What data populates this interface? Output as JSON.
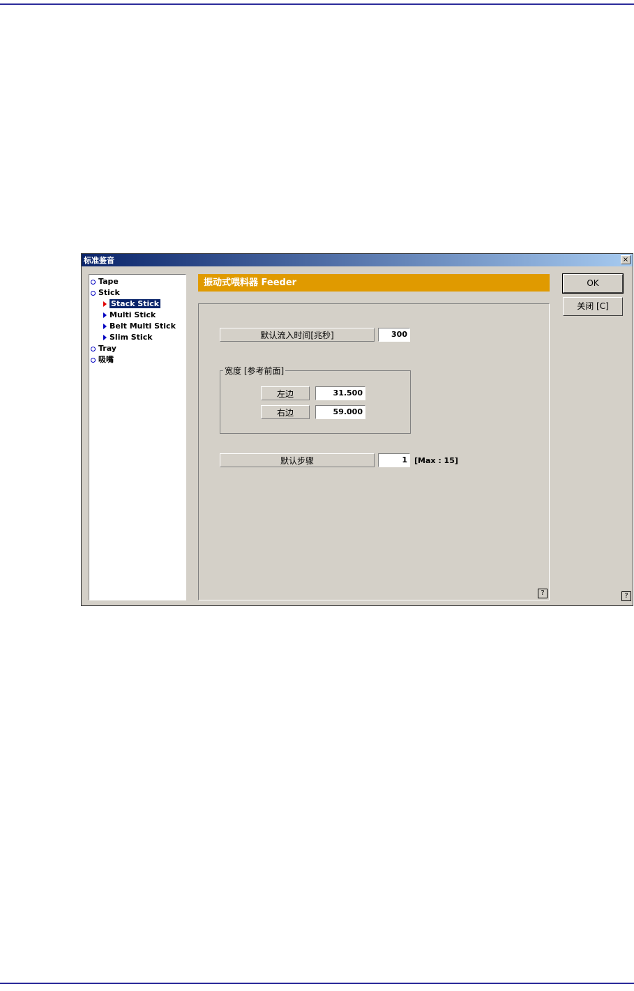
{
  "dialog": {
    "title": "标准鉴音",
    "close_glyph": "×"
  },
  "tree": {
    "items": [
      {
        "label": "Tape",
        "icon": "circle-bullet-icon"
      },
      {
        "label": "Stick",
        "icon": "circle-bullet-icon"
      },
      {
        "label": "Stack Stick",
        "icon": "red-triangle-icon",
        "selected": true
      },
      {
        "label": "Multi Stick",
        "icon": "triangle-icon"
      },
      {
        "label": "Belt Multi Stick",
        "icon": "triangle-icon"
      },
      {
        "label": "Slim Stick",
        "icon": "triangle-icon"
      },
      {
        "label": "Tray",
        "icon": "circle-bullet-icon"
      },
      {
        "label": "吸嘴",
        "icon": "circle-bullet-icon"
      }
    ]
  },
  "content": {
    "header": "振动式喂料器 Feeder",
    "inflow_time": {
      "label": "默认流入时间[兆秒]",
      "value": "300"
    },
    "width_group": {
      "label": "宽度 [参考前面]",
      "left": {
        "label": "左边",
        "value": "31.500"
      },
      "right": {
        "label": "右边",
        "value": "59.000"
      }
    },
    "default_step": {
      "label": "默认步骤",
      "value": "1",
      "max_note": "[Max : 15]"
    },
    "help_glyph": "?"
  },
  "buttons": {
    "ok": "OK",
    "close": "关闭 [C]",
    "help_glyph": "?"
  },
  "colors": {
    "header_bg": "#e09a00",
    "titlebar": "#0a246a",
    "selection": "#0a246a",
    "tree_bullet": "#0000c0",
    "selected_arrow": "#e00000"
  }
}
